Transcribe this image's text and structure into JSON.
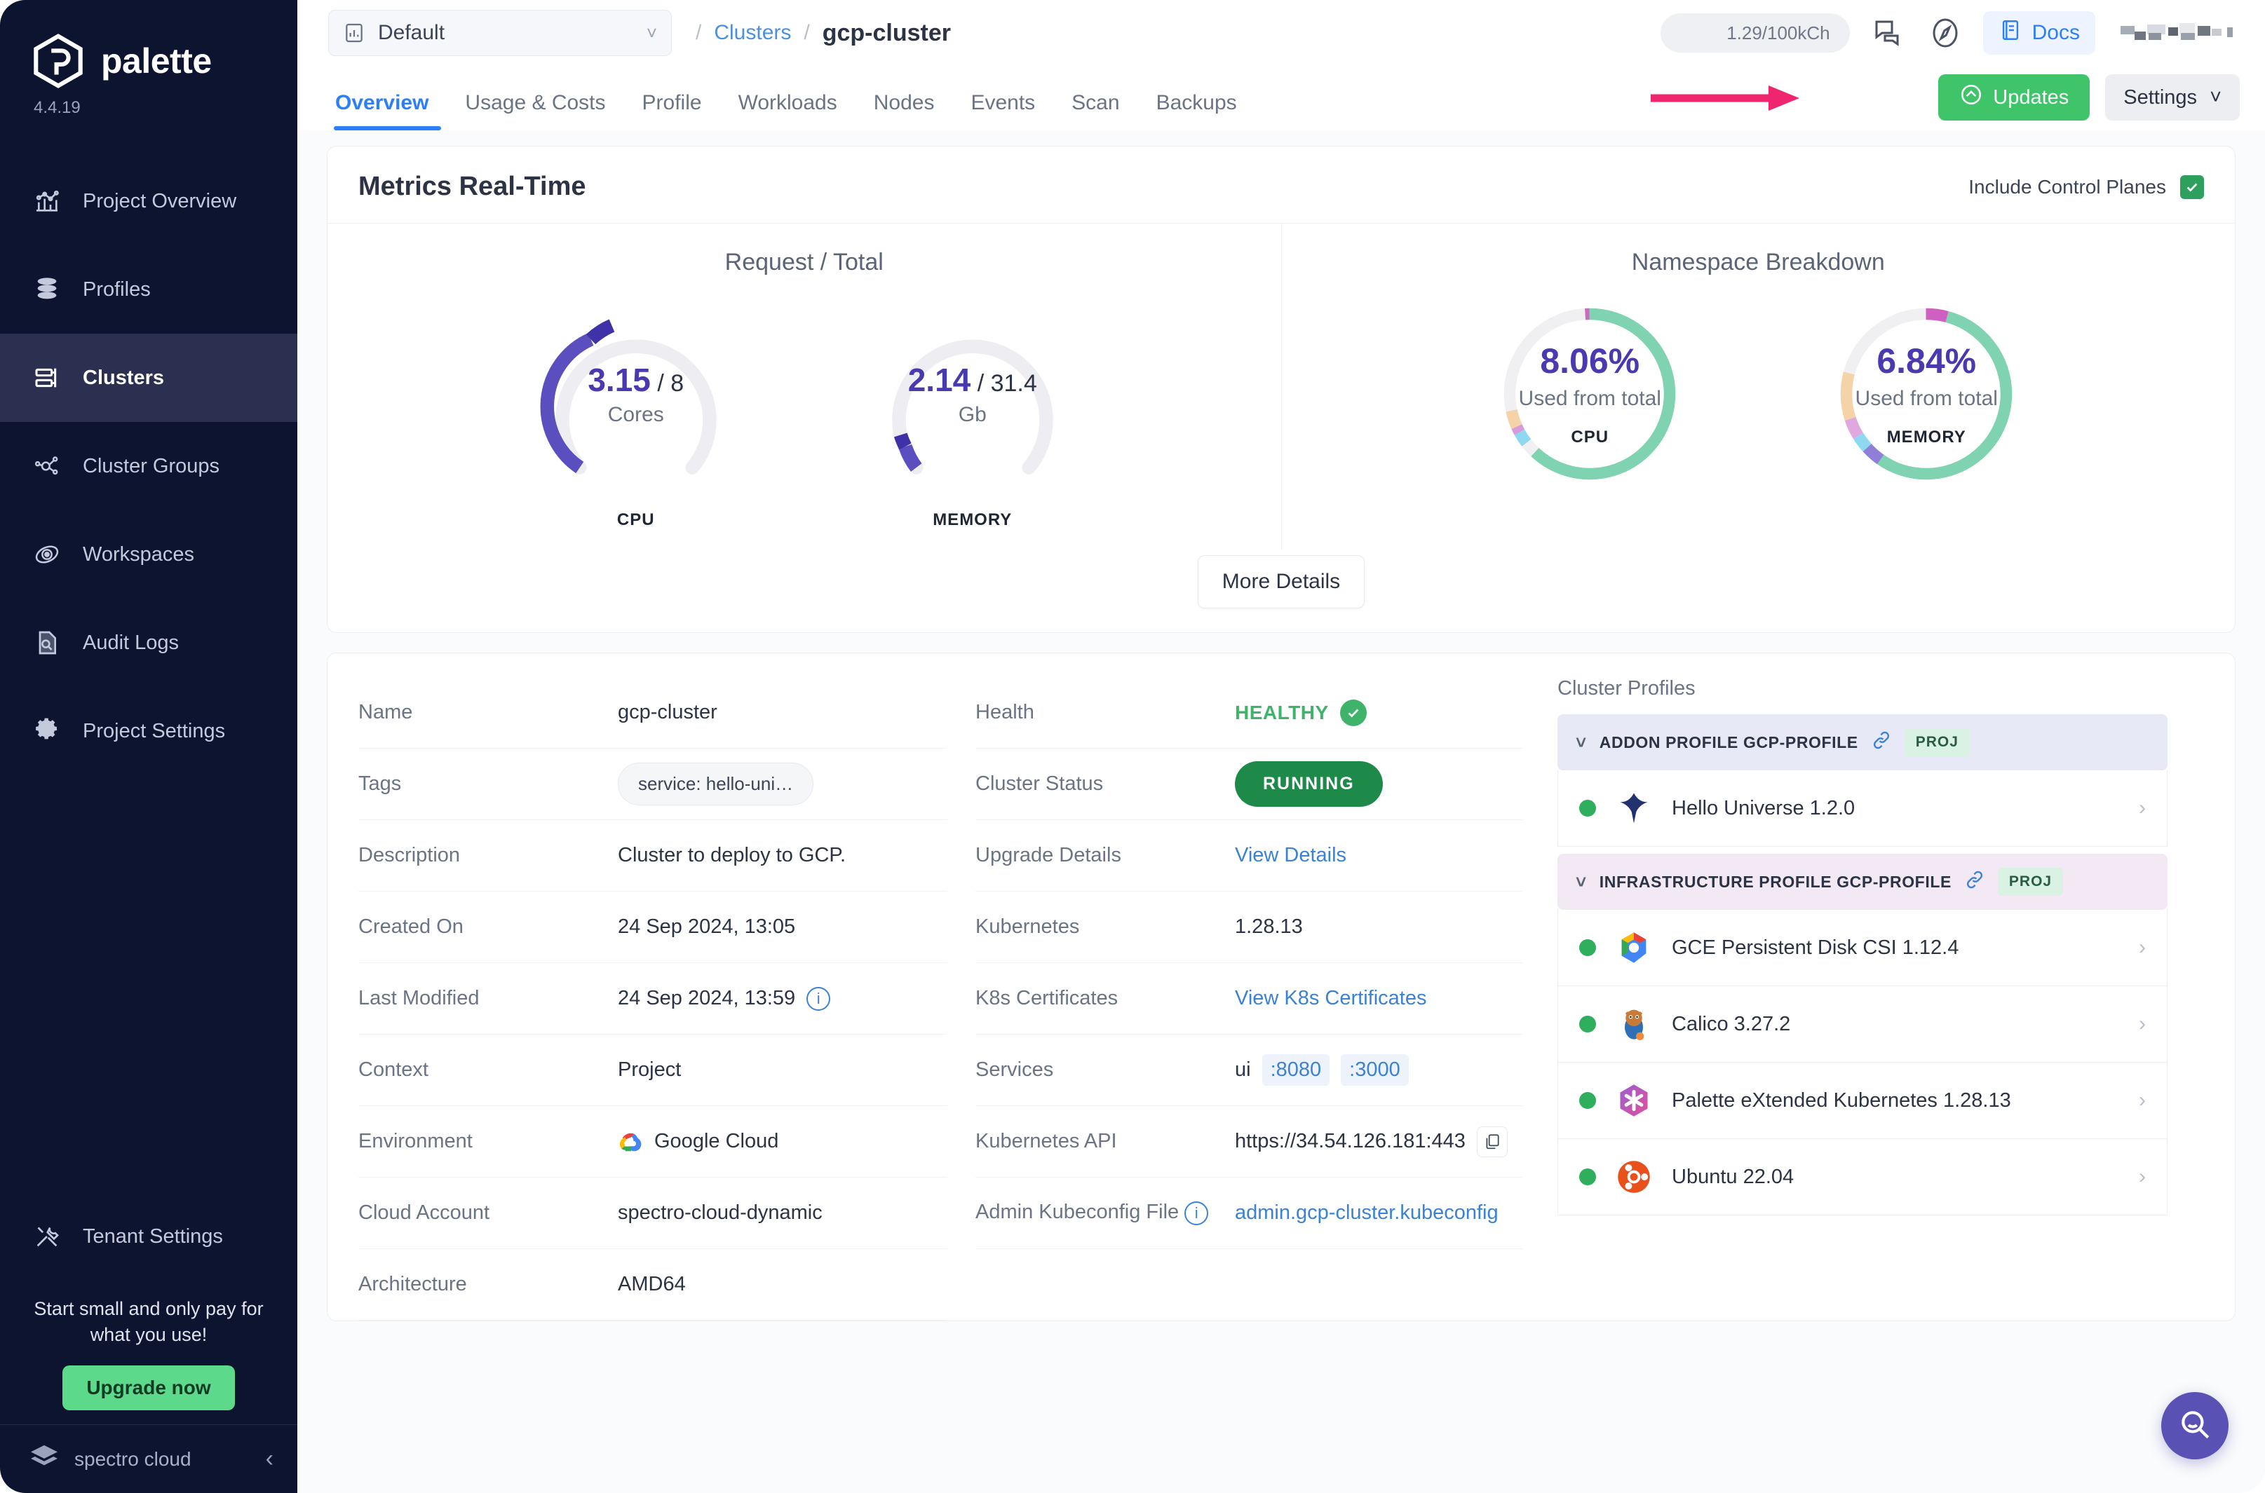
{
  "sidebar": {
    "brand": "palette",
    "version": "4.4.19",
    "items": [
      {
        "label": "Project Overview",
        "icon": "chart-icon"
      },
      {
        "label": "Profiles",
        "icon": "layers-icon"
      },
      {
        "label": "Clusters",
        "icon": "clusters-icon"
      },
      {
        "label": "Cluster Groups",
        "icon": "cluster-groups-icon"
      },
      {
        "label": "Workspaces",
        "icon": "workspaces-icon"
      },
      {
        "label": "Audit Logs",
        "icon": "audit-logs-icon"
      },
      {
        "label": "Project Settings",
        "icon": "gear-icon"
      }
    ],
    "tenant_settings": "Tenant Settings",
    "promo_text": "Start small and only pay for what you use!",
    "upgrade_label": "Upgrade now",
    "footer_brand": "spectro cloud"
  },
  "topbar": {
    "project_name": "Default",
    "breadcrumb_parent": "Clusters",
    "breadcrumb_current": "gcp-cluster",
    "credits": "1.29/100kCh",
    "docs_label": "Docs"
  },
  "tabs": [
    {
      "label": "Overview",
      "active": true
    },
    {
      "label": "Usage & Costs",
      "active": false
    },
    {
      "label": "Profile",
      "active": false
    },
    {
      "label": "Workloads",
      "active": false
    },
    {
      "label": "Nodes",
      "active": false
    },
    {
      "label": "Events",
      "active": false
    },
    {
      "label": "Scan",
      "active": false
    },
    {
      "label": "Backups",
      "active": false
    }
  ],
  "actions": {
    "updates_label": "Updates",
    "settings_label": "Settings"
  },
  "metrics": {
    "title": "Metrics Real-Time",
    "include_control_planes_label": "Include Control Planes",
    "include_control_planes_checked": true,
    "left_title": "Request / Total",
    "right_title": "Namespace Breakdown",
    "more_details_label": "More Details"
  },
  "chart_data": [
    {
      "type": "gauge",
      "title": "Request / Total",
      "label": "CPU",
      "value": 3.15,
      "total": 8,
      "value_text": "3.15",
      "total_text": "8",
      "unit": "Cores",
      "percent": 39.4,
      "arc_color": "#3f32a8",
      "track_color": "#ededf2"
    },
    {
      "type": "gauge",
      "title": "Request / Total",
      "label": "MEMORY",
      "value": 2.14,
      "total": 31.4,
      "value_text": "2.14",
      "total_text": "31.4",
      "unit": "Gb",
      "percent": 6.8,
      "arc_color": "#3f32a8",
      "track_color": "#ededf2"
    },
    {
      "type": "pie",
      "title": "Namespace Breakdown",
      "label": "CPU",
      "center_value": "8.06%",
      "center_sub": "Used from total",
      "values": [
        62.0,
        2.0,
        2.5,
        1.0,
        0.6,
        31.4,
        0.5
      ],
      "colors": [
        "#7fd3b0",
        "#f5d3a8",
        "#d89ad8",
        "#8fd8f2",
        "#7a6fd0",
        "#f0f0f3",
        "#c96bbf"
      ],
      "track_color": "#f0f0f3"
    },
    {
      "type": "pie",
      "title": "Namespace Breakdown",
      "label": "MEMORY",
      "center_value": "6.84%",
      "center_sub": "Used from total",
      "values": [
        55.0,
        2.0,
        1.6,
        2.2,
        8.0,
        12.0,
        14.0,
        5.2
      ],
      "colors": [
        "#7fd3b0",
        "#8f7fd8",
        "#8fd8f2",
        "#e0a8e0",
        "#f5d3a8",
        "#f0f0f3",
        "#cf5fc0",
        "#7fd3b0"
      ],
      "track_color": "#f0f0f3"
    }
  ],
  "details_left": [
    {
      "key": "Name",
      "value": "gcp-cluster",
      "type": "text"
    },
    {
      "key": "Tags",
      "value": "service: hello-uni…",
      "type": "tag"
    },
    {
      "key": "Description",
      "value": "Cluster to deploy to GCP.",
      "type": "text"
    },
    {
      "key": "Created On",
      "value": "24 Sep 2024, 13:05",
      "type": "text"
    },
    {
      "key": "Last Modified",
      "value": "24 Sep 2024, 13:59",
      "type": "text-info"
    },
    {
      "key": "Context",
      "value": "Project",
      "type": "text"
    },
    {
      "key": "Environment",
      "value": "Google Cloud",
      "type": "gcp"
    },
    {
      "key": "Cloud Account",
      "value": "spectro-cloud-dynamic",
      "type": "text"
    },
    {
      "key": "Architecture",
      "value": "AMD64",
      "type": "text"
    }
  ],
  "details_mid": [
    {
      "key": "Health",
      "value": "HEALTHY",
      "type": "health"
    },
    {
      "key": "Cluster Status",
      "value": "RUNNING",
      "type": "badge"
    },
    {
      "key": "Upgrade Details",
      "value": "View Details",
      "type": "link"
    },
    {
      "key": "Kubernetes",
      "value": "1.28.13",
      "type": "text"
    },
    {
      "key": "K8s Certificates",
      "value": "View K8s Certificates",
      "type": "link"
    },
    {
      "key": "Services",
      "value": "ui",
      "type": "services",
      "ports": [
        ":8080",
        ":3000"
      ]
    },
    {
      "key": "Kubernetes API",
      "value": "https://34.54.126.181:443",
      "type": "copy"
    },
    {
      "key": "Admin Kubeconfig File",
      "value": "admin.gcp-cluster.kubeconfig",
      "type": "link-info"
    }
  ],
  "cluster_profiles": {
    "title": "Cluster Profiles",
    "groups": [
      {
        "header": "ADDON PROFILE GCP-PROFILE",
        "badge": "PROJ",
        "kind": "addon",
        "layers": [
          {
            "name": "Hello Universe 1.2.0",
            "icon": "hello-universe-icon",
            "status": "healthy"
          }
        ]
      },
      {
        "header": "INFRASTRUCTURE PROFILE GCP-PROFILE",
        "badge": "PROJ",
        "kind": "infra",
        "layers": [
          {
            "name": "GCE Persistent Disk CSI 1.12.4",
            "icon": "gcp-icon",
            "status": "healthy"
          },
          {
            "name": "Calico 3.27.2",
            "icon": "calico-icon",
            "status": "healthy"
          },
          {
            "name": "Palette eXtended Kubernetes 1.28.13",
            "icon": "pxk-icon",
            "status": "healthy"
          },
          {
            "name": "Ubuntu 22.04",
            "icon": "ubuntu-icon",
            "status": "healthy"
          }
        ]
      }
    ]
  },
  "colors": {
    "accent_blue": "#2d7ff9",
    "green": "#3fc46a",
    "purple": "#4a3ab0",
    "sidebar_bg": "#0d1430",
    "annotation_arrow": "#f0256f"
  }
}
